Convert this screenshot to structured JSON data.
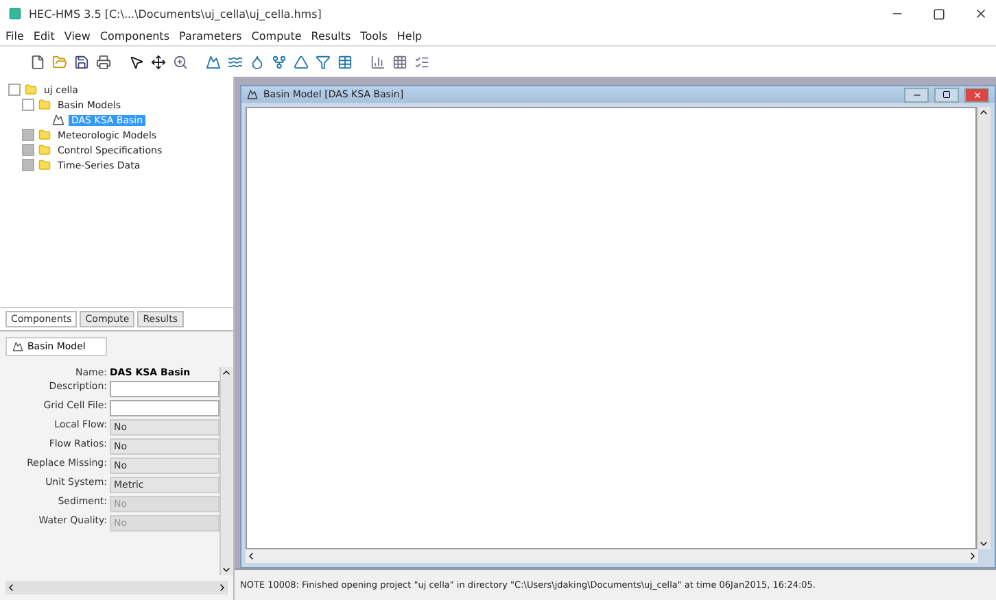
{
  "window": {
    "title": "HEC-HMS 3.5 [C:\\...\\Documents\\uj_cella\\uj_cella.hms]"
  },
  "menu": [
    "File",
    "Edit",
    "View",
    "Components",
    "Parameters",
    "Compute",
    "Results",
    "Tools",
    "Help"
  ],
  "tree": [
    {
      "label": "uj cella",
      "expanded": true,
      "selected": false,
      "children": [
        {
          "label": "Basin Models",
          "expanded": true,
          "selected": false,
          "children": [
            {
              "label": "DAS KSA Basin",
              "selected": true
            }
          ]
        },
        {
          "label": "Meteorologic Models",
          "expanded": false,
          "selected": false
        },
        {
          "label": "Control Specifications",
          "expanded": false,
          "selected": false
        },
        {
          "label": "Time-Series Data",
          "expanded": false,
          "selected": false
        }
      ]
    }
  ],
  "tabs": [
    {
      "label": "Components",
      "selected": true
    },
    {
      "label": "Compute",
      "selected": false
    },
    {
      "label": "Results",
      "selected": false
    }
  ],
  "editor": {
    "tab": "Basin Model",
    "name_label": "Name:",
    "name_value": "DAS KSA Basin",
    "rows": [
      {
        "label": "Description:",
        "kind": "input",
        "disabled": false
      },
      {
        "label": "Grid Cell File:",
        "kind": "input",
        "disabled": false
      },
      {
        "label": "Local Flow:",
        "kind": "select",
        "value": "No",
        "disabled": false
      },
      {
        "label": "Flow Ratios:",
        "kind": "select",
        "value": "No",
        "disabled": false
      },
      {
        "label": "Replace Missing:",
        "kind": "select",
        "value": "No",
        "disabled": false
      },
      {
        "label": "Unit System:",
        "kind": "select",
        "value": "Metric",
        "disabled": false
      },
      {
        "label": "Sediment:",
        "kind": "select",
        "value": "No",
        "disabled": true
      },
      {
        "label": "Water Quality:",
        "kind": "select",
        "value": "No",
        "disabled": true
      }
    ]
  },
  "inner_window": {
    "title": "Basin Model [DAS KSA Basin]"
  },
  "status_bar": "NOTE 10008: Finished opening project \"uj cella\" in directory \"C:\\Users\\jdaking\\Documents\\uj_cella\" at time 06Jan2015, 16:24:05."
}
